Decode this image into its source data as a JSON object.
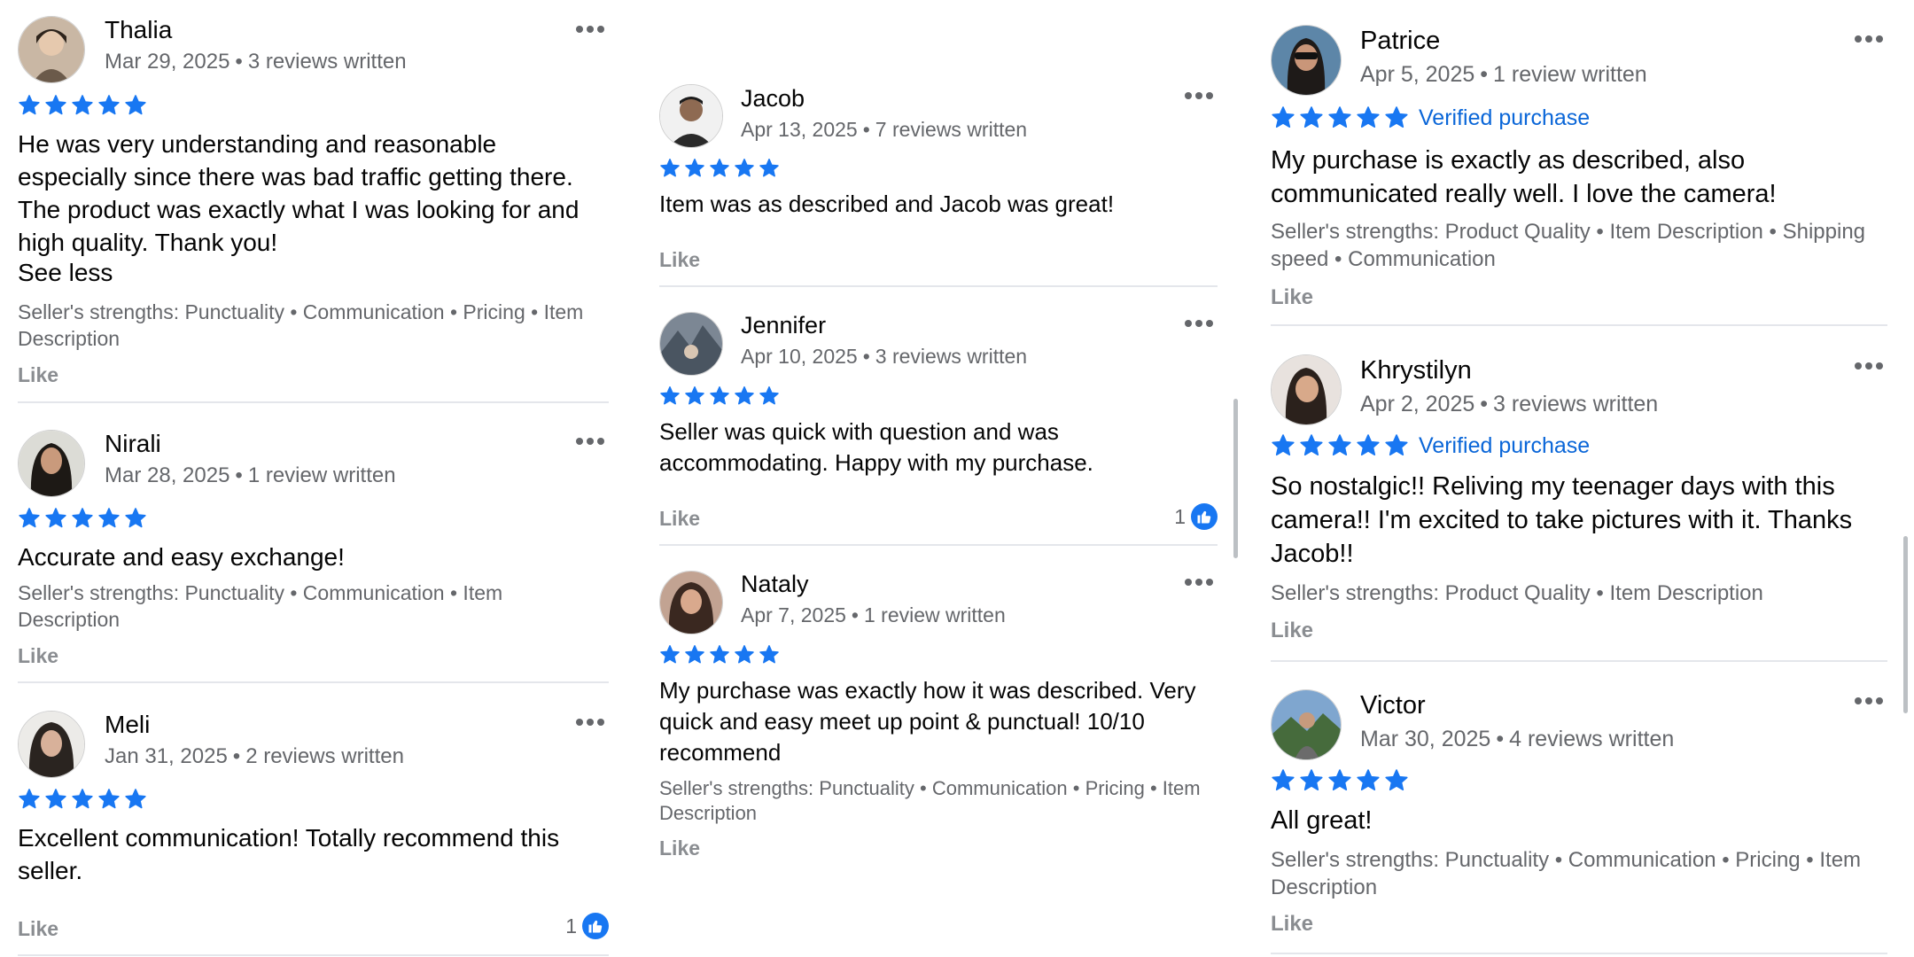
{
  "colors": {
    "accent": "#0a66d8",
    "star": "#1877f2",
    "text": "#050505",
    "muted": "#65676b"
  },
  "columns": [
    {
      "reviews": [
        {
          "name": "Thalia",
          "date": "Mar 29, 2025",
          "count": "3 reviews written",
          "rating": 5,
          "text": "He was very understanding and reasonable especially since there was bad traffic getting there. The product was exactly what I was looking for and high quality. Thank you!",
          "see_less": "See less",
          "strengths": "Seller's strengths: Punctuality • Communication • Pricing • Item Description",
          "like": "Like"
        },
        {
          "name": "Nirali",
          "date": "Mar 28, 2025",
          "count": "1 review written",
          "rating": 5,
          "text": "Accurate and easy exchange!",
          "strengths": "Seller's strengths: Punctuality • Communication • Item Description",
          "like": "Like"
        },
        {
          "name": "Meli",
          "date": "Jan 31, 2025",
          "count": "2 reviews written",
          "rating": 5,
          "text": "Excellent communication! Totally recommend this seller.",
          "like": "Like",
          "reaction_count": "1"
        }
      ]
    },
    {
      "reviews": [
        {
          "name": "Jacob",
          "date": "Apr 13, 2025",
          "count": "7 reviews written",
          "rating": 5,
          "text": "Item was as described and Jacob was great!",
          "like": "Like"
        },
        {
          "name": "Jennifer",
          "date": "Apr 10, 2025",
          "count": "3 reviews written",
          "rating": 5,
          "text": "Seller was quick with question and was accommodating. Happy with my purchase.",
          "like": "Like",
          "reaction_count": "1"
        },
        {
          "name": "Nataly",
          "date": "Apr 7, 2025",
          "count": "1 review written",
          "rating": 5,
          "text": "My purchase was exactly how it was described. Very quick and easy meet up point & punctual! 10/10 recommend",
          "strengths": "Seller's strengths: Punctuality • Communication • Pricing • Item Description",
          "like": "Like"
        }
      ]
    },
    {
      "reviews": [
        {
          "name": "Patrice",
          "date": "Apr 5, 2025",
          "count": "1 review written",
          "rating": 5,
          "verified": "Verified purchase",
          "text": "My purchase is exactly as described, also communicated really well. I love the camera!",
          "strengths": "Seller's strengths: Product Quality • Item Description • Shipping speed • Communication",
          "like": "Like"
        },
        {
          "name": "Khrystilyn",
          "date": "Apr 2, 2025",
          "count": "3 reviews written",
          "rating": 5,
          "verified": "Verified purchase",
          "text": "So nostalgic!! Reliving my teenager days with this camera!! I'm excited to take pictures with it. Thanks Jacob!!",
          "strengths": "Seller's strengths: Product Quality • Item Description",
          "like": "Like"
        },
        {
          "name": "Victor",
          "date": "Mar 30, 2025",
          "count": "4 reviews written",
          "rating": 5,
          "text": "All great!",
          "strengths": "Seller's strengths: Punctuality • Communication • Pricing • Item Description",
          "like": "Like"
        }
      ]
    }
  ]
}
